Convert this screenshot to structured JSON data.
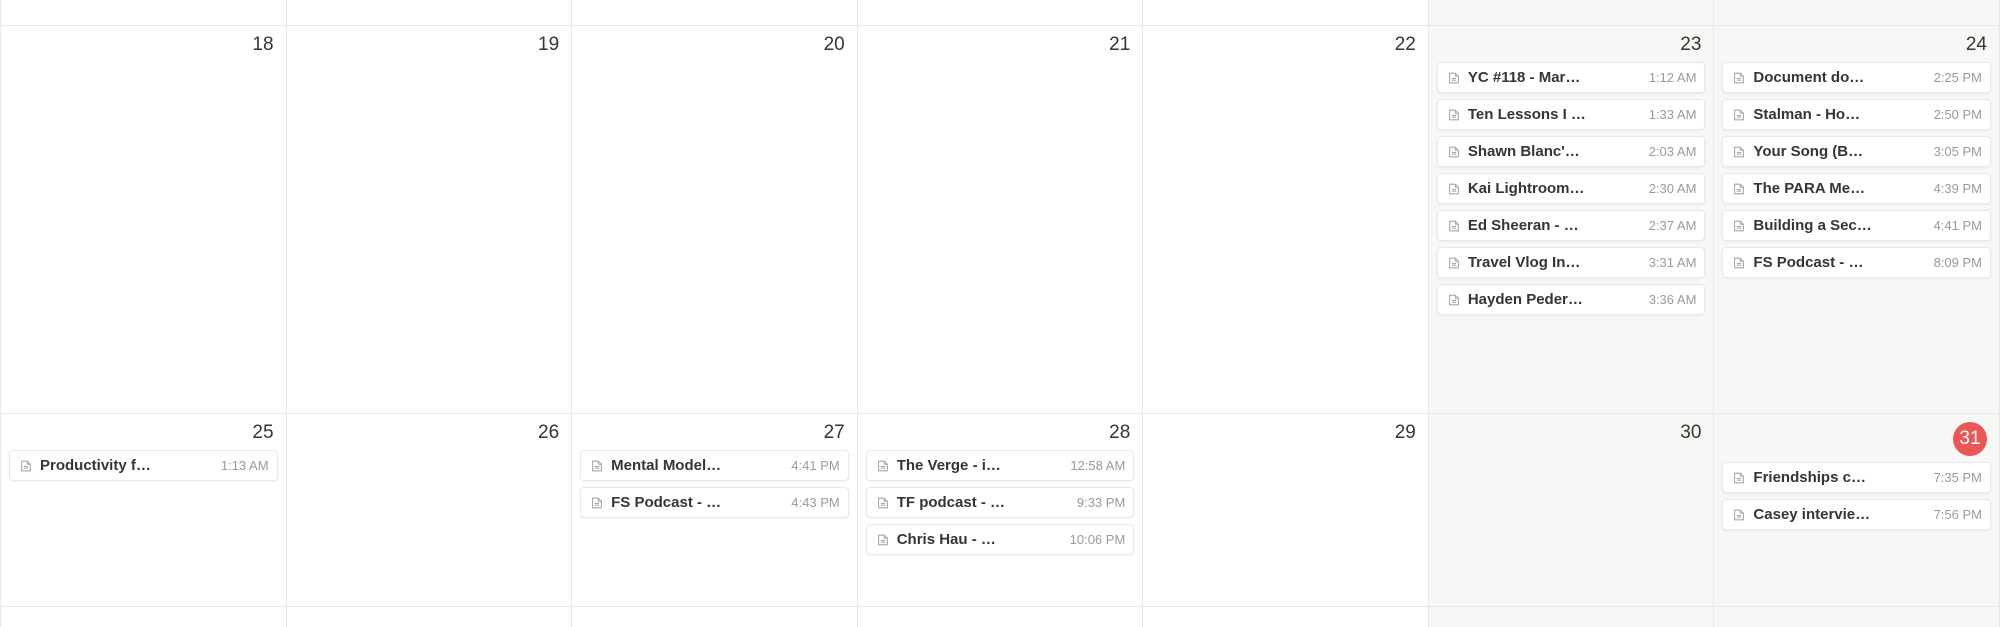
{
  "rows": [
    {
      "type": "first",
      "days": [
        {
          "weekend": false
        },
        {
          "weekend": false
        },
        {
          "weekend": false
        },
        {
          "weekend": false
        },
        {
          "weekend": false
        },
        {
          "weekend": true
        },
        {
          "weekend": true
        }
      ]
    },
    {
      "type": "middle",
      "days": [
        {
          "number": "18",
          "weekend": false,
          "events": []
        },
        {
          "number": "19",
          "weekend": false,
          "events": []
        },
        {
          "number": "20",
          "weekend": false,
          "events": []
        },
        {
          "number": "21",
          "weekend": false,
          "events": []
        },
        {
          "number": "22",
          "weekend": false,
          "events": []
        },
        {
          "number": "23",
          "weekend": true,
          "events": [
            {
              "title": "YC #118 - Mar…",
              "time": "1:12 AM"
            },
            {
              "title": "Ten Lessons I …",
              "time": "1:33 AM"
            },
            {
              "title": "Shawn Blanc'…",
              "time": "2:03 AM"
            },
            {
              "title": "Kai Lightroom…",
              "time": "2:30 AM"
            },
            {
              "title": "Ed Sheeran - …",
              "time": "2:37 AM"
            },
            {
              "title": "Travel Vlog In…",
              "time": "3:31 AM"
            },
            {
              "title": "Hayden Peder…",
              "time": "3:36 AM"
            }
          ]
        },
        {
          "number": "24",
          "weekend": true,
          "events": [
            {
              "title": "Document do…",
              "time": "2:25 PM"
            },
            {
              "title": "Stalman - Ho…",
              "time": "2:50 PM"
            },
            {
              "title": "Your Song (B…",
              "time": "3:05 PM"
            },
            {
              "title": "The PARA Me…",
              "time": "4:39 PM"
            },
            {
              "title": "Building a Sec…",
              "time": "4:41 PM"
            },
            {
              "title": "FS Podcast - …",
              "time": "8:09 PM"
            }
          ]
        }
      ]
    },
    {
      "type": "bottom",
      "days": [
        {
          "number": "25",
          "weekend": false,
          "events": [
            {
              "title": "Productivity f…",
              "time": "1:13 AM"
            }
          ]
        },
        {
          "number": "26",
          "weekend": false,
          "events": []
        },
        {
          "number": "27",
          "weekend": false,
          "events": [
            {
              "title": "Mental Model…",
              "time": "4:41 PM"
            },
            {
              "title": "FS Podcast - …",
              "time": "4:43 PM"
            }
          ]
        },
        {
          "number": "28",
          "weekend": false,
          "events": [
            {
              "title": "The Verge - i…",
              "time": "12:58 AM"
            },
            {
              "title": "TF podcast - …",
              "time": "9:33 PM"
            },
            {
              "title": "Chris Hau - …",
              "time": "10:06 PM"
            }
          ]
        },
        {
          "number": "29",
          "weekend": false,
          "events": []
        },
        {
          "number": "30",
          "weekend": true,
          "events": []
        },
        {
          "number": "31",
          "weekend": true,
          "today": true,
          "events": [
            {
              "title": "Friendships c…",
              "time": "7:35 PM"
            },
            {
              "title": "Casey intervie…",
              "time": "7:56 PM"
            }
          ]
        }
      ]
    },
    {
      "type": "last",
      "days": [
        {
          "weekend": false
        },
        {
          "weekend": false
        },
        {
          "weekend": false
        },
        {
          "weekend": false
        },
        {
          "weekend": false
        },
        {
          "weekend": true
        },
        {
          "weekend": true
        }
      ]
    }
  ]
}
